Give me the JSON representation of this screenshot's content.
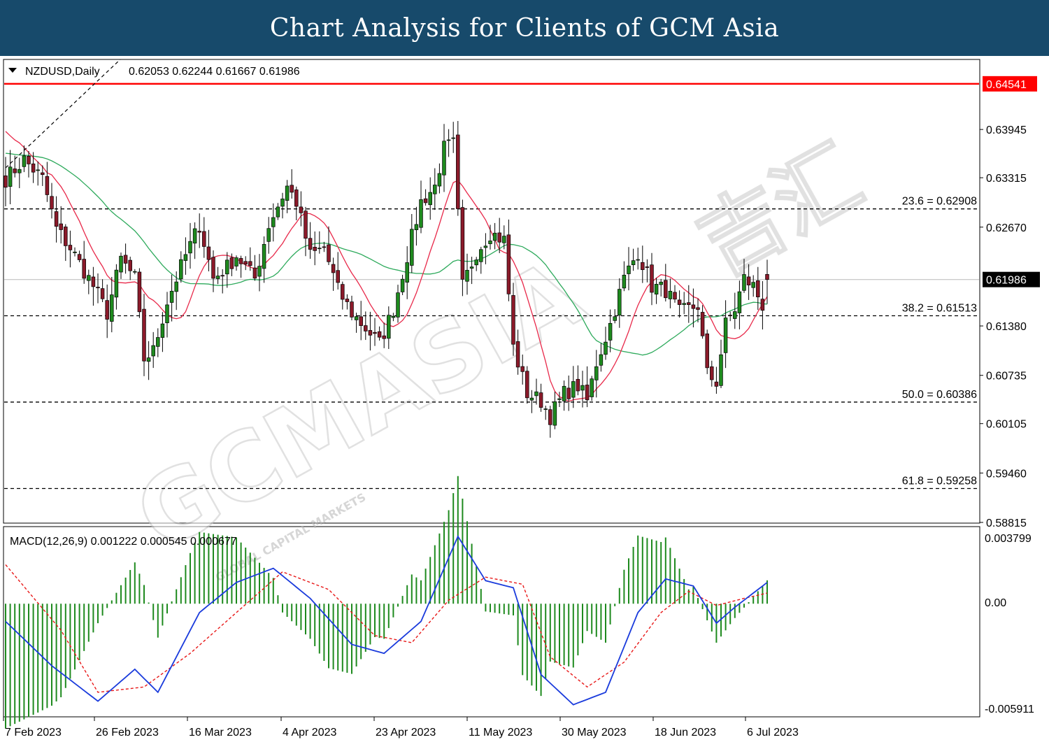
{
  "banner": {
    "title": "Chart Analysis for Clients of GCM Asia"
  },
  "header": {
    "symbol_label": "NZDUSD,Daily",
    "ohlc_values": "0.62053 0.62244 0.61667 0.61986"
  },
  "macd": {
    "label": "MACD(12,26,9) 0.001222 0.000545 0.000677",
    "axis_top": "0.003799",
    "axis_zero": "0.00",
    "axis_bottom": "-0.005911",
    "range": [
      -0.005911,
      0.003799
    ]
  },
  "watermark": {
    "main": "GCMASIA",
    "sub": "GLOBAL CAPITAL MARKETS",
    "cn": "吉汇"
  },
  "colors": {
    "banner": "#174a6b",
    "bull": "#1e8a1e",
    "bear": "#8b1a2a",
    "ma_fast": "#e8294a",
    "ma_slow": "#2eaa5c",
    "resistance": "#ff0000",
    "macd_line": "#1a3bdc",
    "signal_line": "#e81818",
    "histogram": "#1e8a1e"
  },
  "chart_data": {
    "type": "candlestick",
    "symbol": "NZDUSD",
    "timeframe": "Daily",
    "ylim": [
      0.58815,
      0.6485
    ],
    "y_ticks": [
      "0.63945",
      "0.63315",
      "0.62670",
      "0.61380",
      "0.60735",
      "0.60105",
      "0.59460",
      "0.58815"
    ],
    "x_ticks": [
      "7 Feb 2023",
      "26 Feb 2023",
      "16 Mar 2023",
      "4 Apr 2023",
      "23 Apr 2023",
      "11 May 2023",
      "30 May 2023",
      "18 Jun 2023",
      "6 Jul 2023"
    ],
    "resistance": {
      "value": 0.64541,
      "label": "0.64541"
    },
    "current_price": {
      "value": 0.61986,
      "label": "0.61986"
    },
    "fib_levels": [
      {
        "value": 0.62908,
        "label": "23.6 = 0.62908"
      },
      {
        "value": 0.61513,
        "label": "38.2 = 0.61513"
      },
      {
        "value": 0.60386,
        "label": "50.0 = 0.60386"
      },
      {
        "value": 0.59258,
        "label": "61.8 = 0.59258"
      }
    ],
    "close_path": [
      [
        0,
        0.633
      ],
      [
        4,
        0.6355
      ],
      [
        8,
        0.633
      ],
      [
        11,
        0.6265
      ],
      [
        14,
        0.624
      ],
      [
        19,
        0.619
      ],
      [
        22,
        0.6155
      ],
      [
        25,
        0.6225
      ],
      [
        28,
        0.62
      ],
      [
        30,
        0.6095
      ],
      [
        32,
        0.6105
      ],
      [
        35,
        0.617
      ],
      [
        39,
        0.623
      ],
      [
        42,
        0.627
      ],
      [
        45,
        0.62
      ],
      [
        48,
        0.6215
      ],
      [
        50,
        0.623
      ],
      [
        54,
        0.62
      ],
      [
        57,
        0.627
      ],
      [
        61,
        0.632
      ],
      [
        63,
        0.63
      ],
      [
        66,
        0.623
      ],
      [
        69,
        0.624
      ],
      [
        72,
        0.6185
      ],
      [
        75,
        0.6155
      ],
      [
        78,
        0.6135
      ],
      [
        81,
        0.6115
      ],
      [
        84,
        0.616
      ],
      [
        87,
        0.623
      ],
      [
        90,
        0.63
      ],
      [
        93,
        0.632
      ],
      [
        95,
        0.637
      ],
      [
        97,
        0.6375
      ],
      [
        99,
        0.619
      ],
      [
        102,
        0.6235
      ],
      [
        105,
        0.626
      ],
      [
        108,
        0.625
      ],
      [
        110,
        0.611
      ],
      [
        113,
        0.605
      ],
      [
        116,
        0.604
      ],
      [
        118,
        0.602
      ],
      [
        121,
        0.605
      ],
      [
        124,
        0.606
      ],
      [
        126,
        0.604
      ],
      [
        128,
        0.609
      ],
      [
        131,
        0.614
      ],
      [
        134,
        0.62
      ],
      [
        137,
        0.6235
      ],
      [
        140,
        0.619
      ],
      [
        143,
        0.6185
      ],
      [
        146,
        0.6155
      ],
      [
        148,
        0.616
      ],
      [
        150,
        0.6165
      ],
      [
        152,
        0.6075
      ],
      [
        154,
        0.6065
      ],
      [
        156,
        0.614
      ],
      [
        158,
        0.616
      ],
      [
        160,
        0.62
      ],
      [
        162,
        0.619
      ],
      [
        164,
        0.6165
      ],
      [
        165,
        0.6199
      ]
    ],
    "macd_path": [
      [
        0,
        -0.001
      ],
      [
        10,
        -0.0035
      ],
      [
        20,
        -0.0055
      ],
      [
        28,
        -0.0037
      ],
      [
        33,
        -0.005
      ],
      [
        42,
        -0.0005
      ],
      [
        50,
        0.0012
      ],
      [
        58,
        0.002
      ],
      [
        66,
        0.0003
      ],
      [
        75,
        -0.0023
      ],
      [
        82,
        -0.0028
      ],
      [
        90,
        -0.001
      ],
      [
        98,
        0.0038
      ],
      [
        104,
        0.0013
      ],
      [
        110,
        0.0009
      ],
      [
        116,
        -0.004
      ],
      [
        123,
        -0.0057
      ],
      [
        130,
        -0.005
      ],
      [
        137,
        -0.0005
      ],
      [
        143,
        0.0014
      ],
      [
        149,
        0.001
      ],
      [
        154,
        -0.0011
      ],
      [
        158,
        -0.0002
      ],
      [
        165,
        0.0012
      ]
    ],
    "signal_path": [
      [
        0,
        0.0022
      ],
      [
        12,
        -0.0015
      ],
      [
        20,
        -0.005
      ],
      [
        30,
        -0.0047
      ],
      [
        40,
        -0.0028
      ],
      [
        50,
        -0.0005
      ],
      [
        60,
        0.0018
      ],
      [
        70,
        0.0008
      ],
      [
        80,
        -0.0018
      ],
      [
        88,
        -0.0022
      ],
      [
        96,
        0.0002
      ],
      [
        104,
        0.0015
      ],
      [
        112,
        0.0011
      ],
      [
        118,
        -0.003
      ],
      [
        126,
        -0.0047
      ],
      [
        134,
        -0.0033
      ],
      [
        142,
        -0.0005
      ],
      [
        148,
        0.0007
      ],
      [
        154,
        -0.0001
      ],
      [
        160,
        0.0003
      ],
      [
        165,
        0.0006
      ]
    ]
  }
}
